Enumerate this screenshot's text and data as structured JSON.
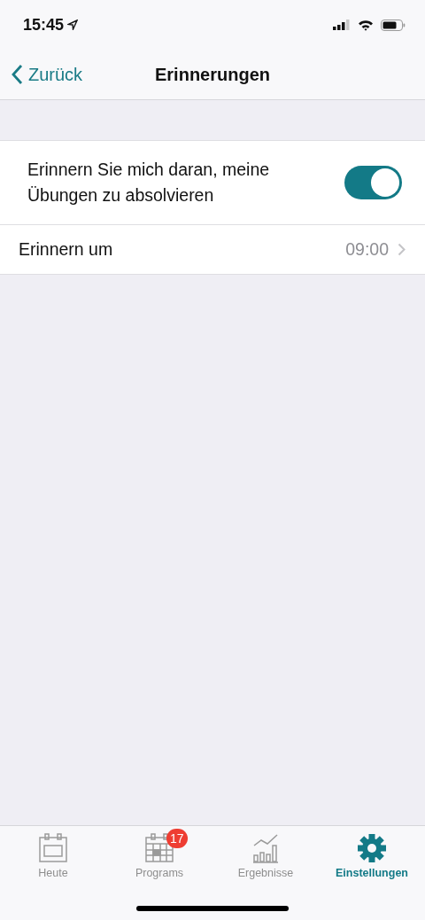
{
  "status_bar": {
    "time": "15:45"
  },
  "nav": {
    "back": "Zurück",
    "title": "Erinnerungen"
  },
  "settings": [
    {
      "kind": "toggle",
      "label": "Erinnern Sie mich daran, meine Übungen zu absolvieren",
      "on": true
    },
    {
      "kind": "detail",
      "label": "Erinnern um",
      "value": "09:00"
    }
  ],
  "tabs": [
    {
      "label": "Heute",
      "kind": "calendar",
      "selected": false
    },
    {
      "label": "Programs",
      "kind": "grid",
      "selected": false,
      "badge": "17"
    },
    {
      "label": "Ergebnisse",
      "kind": "chart",
      "selected": false
    },
    {
      "label": "Einstellungen",
      "kind": "gear",
      "selected": true
    }
  ]
}
